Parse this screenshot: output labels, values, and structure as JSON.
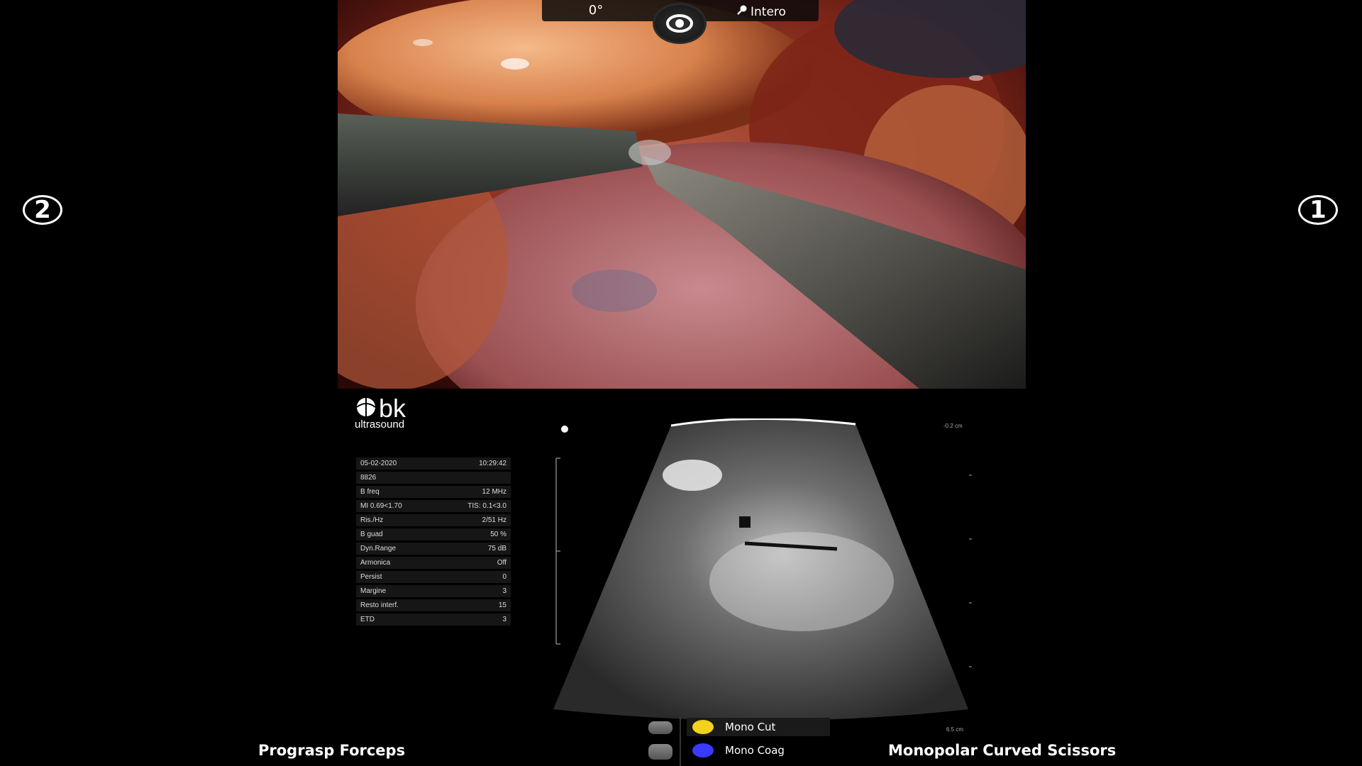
{
  "arms": {
    "left": "2",
    "right": "1"
  },
  "endoscope": {
    "angle": "0°",
    "zoom_label": "Intero"
  },
  "ultrasound": {
    "brand": "bk",
    "brand_sub": "ultrasound",
    "params": [
      {
        "label": "05-02-2020",
        "value": "10:29:42"
      },
      {
        "label": "8826",
        "value": ""
      },
      {
        "label": "B freq",
        "value": "12 MHz"
      },
      {
        "label": "MI 0.69<1.70",
        "value": "TIS: 0.1<3.0"
      },
      {
        "label": "Ris./Hz",
        "value": "2/51 Hz"
      },
      {
        "label": "B guad",
        "value": "50 %"
      },
      {
        "label": "Dyn.Range",
        "value": "75 dB"
      },
      {
        "label": "Armonica",
        "value": "Off"
      },
      {
        "label": "Persist",
        "value": "0"
      },
      {
        "label": "Margine",
        "value": "3"
      },
      {
        "label": "Resto interf.",
        "value": "15"
      },
      {
        "label": "ETD",
        "value": "3"
      }
    ],
    "depth_top": "-0.2 cm",
    "depth_bottom": "6.5 cm"
  },
  "instruments": {
    "left": "Prograsp Forceps",
    "right": "Monopolar Curved Scissors"
  },
  "energy": {
    "cut_label": "Mono Cut",
    "coag_label": "Mono Coag",
    "cut_color": "#f2d21a",
    "coag_color": "#3a3aff"
  }
}
